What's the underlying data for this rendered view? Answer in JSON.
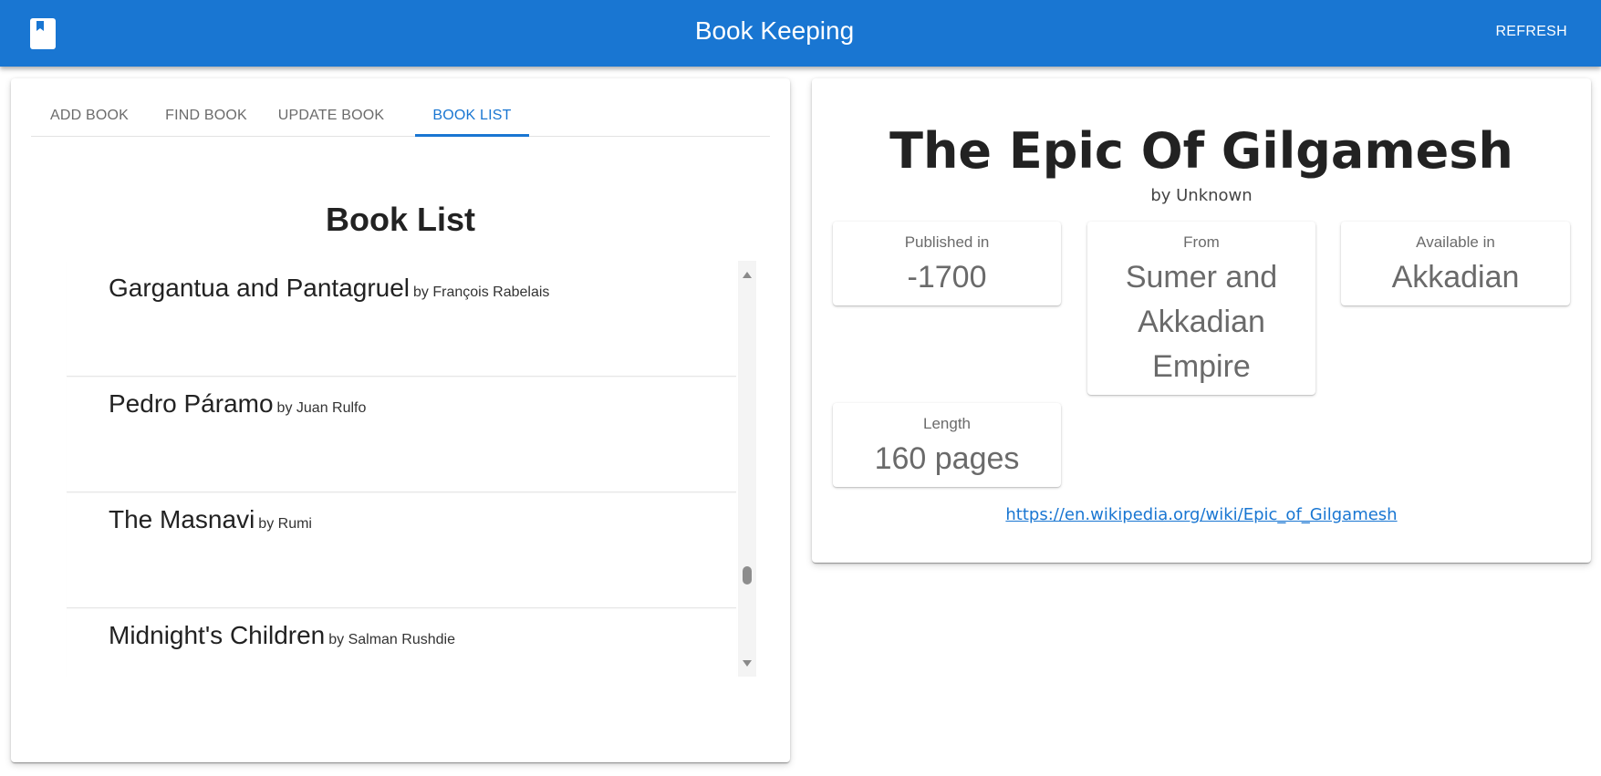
{
  "app": {
    "title": "Book Keeping",
    "refresh_label": "REFRESH",
    "accent_color": "#1976d2",
    "logo_icon": "book-bookmark-icon"
  },
  "tabs": [
    {
      "label": "ADD BOOK",
      "active": false
    },
    {
      "label": "FIND BOOK",
      "active": false
    },
    {
      "label": "UPDATE BOOK",
      "active": false
    },
    {
      "label": "BOOK LIST",
      "active": true
    }
  ],
  "book_list": {
    "title": "Book List",
    "items": [
      {
        "title": "Gargantua and Pantagruel",
        "author": "by François Rabelais"
      },
      {
        "title": "Pedro Páramo",
        "author": "by Juan Rulfo"
      },
      {
        "title": "The Masnavi",
        "author": "by Rumi"
      },
      {
        "title": "Midnight's Children",
        "author": "by Salman Rushdie"
      }
    ]
  },
  "detail": {
    "title": "The Epic Of Gilgamesh",
    "author": "by Unknown",
    "published": {
      "label": "Published in",
      "value": "-1700"
    },
    "from": {
      "label": "From",
      "value": "Sumer and Akkadian Empire"
    },
    "language": {
      "label": "Available in",
      "value": "Akkadian"
    },
    "length": {
      "label": "Length",
      "value": "160 pages"
    },
    "link": "https://en.wikipedia.org/wiki/Epic_of_Gilgamesh"
  }
}
